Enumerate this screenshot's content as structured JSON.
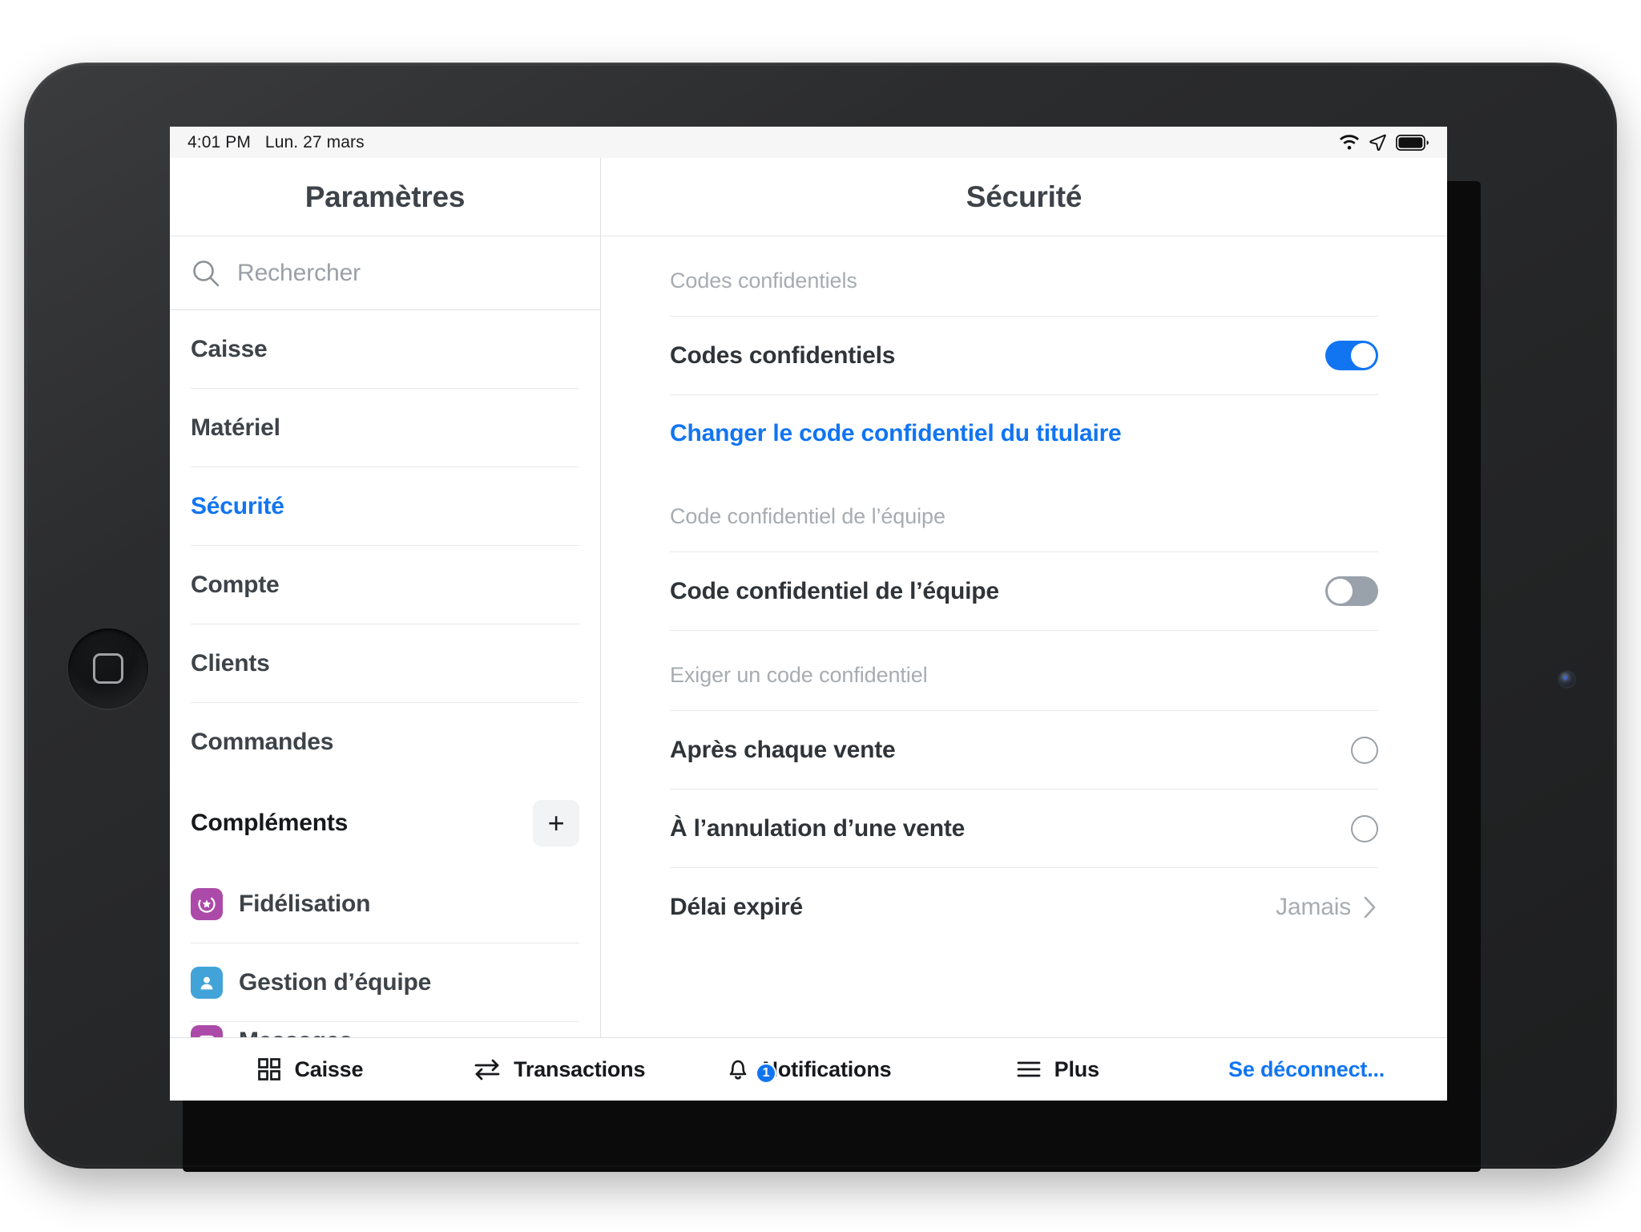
{
  "status_bar": {
    "time": "4:01 PM",
    "date": "Lun. 27 mars",
    "icons": [
      "wifi-icon",
      "location-arrow-icon",
      "battery-icon"
    ]
  },
  "sidebar": {
    "title": "Paramètres",
    "search": {
      "placeholder": "Rechercher",
      "icon": "search-icon"
    },
    "items": [
      {
        "label": "Caisse",
        "active": false
      },
      {
        "label": "Matériel",
        "active": false
      },
      {
        "label": "Sécurité",
        "active": true
      },
      {
        "label": "Compte",
        "active": false
      },
      {
        "label": "Clients",
        "active": false
      },
      {
        "label": "Commandes",
        "active": false
      }
    ],
    "addons_header": {
      "label": "Compléments",
      "add_label": "+"
    },
    "addons": [
      {
        "label": "Fidélisation",
        "icon": "loyalty-star-icon",
        "color": "#ab4aa8"
      },
      {
        "label": "Gestion d’équipe",
        "icon": "team-person-icon",
        "color": "#41a3d8"
      },
      {
        "label": "Messages",
        "icon": "messages-icon",
        "color": "#ab4aa8"
      }
    ]
  },
  "detail": {
    "title": "Sécurité",
    "sections": [
      {
        "label": "Codes confidentiels",
        "rows": [
          {
            "label": "Codes confidentiels",
            "control": "toggle",
            "state": "on"
          }
        ],
        "link": "Changer le code confidentiel du titulaire"
      },
      {
        "label": "Code confidentiel de l’équipe",
        "rows": [
          {
            "label": "Code confidentiel de l’équipe",
            "control": "toggle",
            "state": "off"
          }
        ]
      },
      {
        "label": "Exiger un code confidentiel",
        "rows": [
          {
            "label": "Après chaque vente",
            "control": "radio",
            "state": "off"
          },
          {
            "label": "À l’annulation d’une vente",
            "control": "radio",
            "state": "off"
          },
          {
            "label": "Délai expiré",
            "control": "disclosure",
            "value": "Jamais"
          }
        ]
      }
    ]
  },
  "tab_bar": {
    "items": [
      {
        "label": "Caisse",
        "icon": "grid-icon"
      },
      {
        "label": "Transactions",
        "icon": "transfer-arrows-icon"
      },
      {
        "label": "Notifications",
        "icon": "bell-icon",
        "badge": "1"
      },
      {
        "label": "Plus",
        "icon": "hamburger-icon"
      },
      {
        "label": "Se déconnect...",
        "icon": "logout-link"
      }
    ]
  },
  "colors": {
    "accent_blue": "#1175f2",
    "toggle_off": "#99a1ab",
    "text_primary": "#3d4349",
    "text_muted": "#a7acb1"
  }
}
